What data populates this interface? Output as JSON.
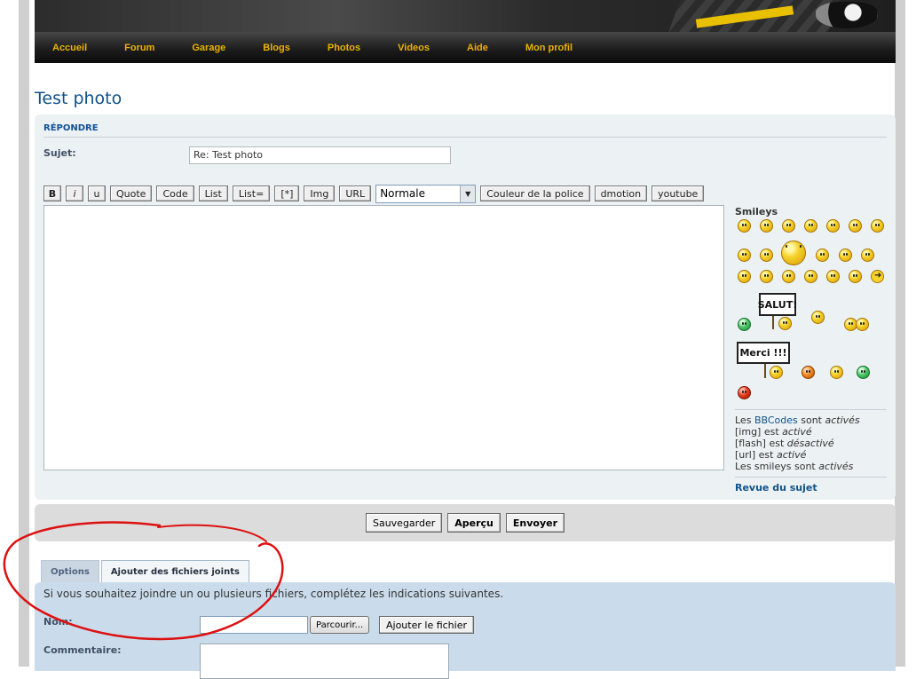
{
  "nav": {
    "items": [
      "Accueil",
      "Forum",
      "Garage",
      "Blogs",
      "Photos",
      "Videos",
      "Aide",
      "Mon profil"
    ]
  },
  "page": {
    "title": "Test photo"
  },
  "post": {
    "section_heading": "RÉPONDRE",
    "subject_label": "Sujet:",
    "subject_value": "Re: Test photo",
    "toolbar": {
      "bold": "B",
      "italic": "i",
      "underline": "u",
      "quote": "Quote",
      "code": "Code",
      "list": "List",
      "list_ordered": "List=",
      "list_item": "[*]",
      "img": "Img",
      "url": "URL",
      "font_size_selected": "Normale",
      "font_color": "Couleur de la police",
      "dmotion": "dmotion",
      "youtube": "youtube"
    }
  },
  "smileys": {
    "title": "Smileys",
    "sign_salut": "SALUT!",
    "sign_merci": "Merci !!!"
  },
  "bbinfo": {
    "line1_prefix": "Les ",
    "line1_link": "BBCodes",
    "line1_mid": " sont ",
    "line1_status": "activés",
    "line2_prefix": "[img] est ",
    "line2_status": "activé",
    "line3_prefix": "[flash] est ",
    "line3_status": "désactivé",
    "line4_prefix": "[url] est ",
    "line4_status": "activé",
    "line5_prefix": "Les smileys sont ",
    "line5_status": "activés",
    "review_link": "Revue du sujet"
  },
  "submit": {
    "save": "Sauvegarder",
    "preview": "Aperçu",
    "send": "Envoyer"
  },
  "tabs": {
    "options": "Options",
    "attachments": "Ajouter des fichiers joints"
  },
  "attach": {
    "intro": "Si vous souhaitez joindre un ou plusieurs fichiers, complétez les indications suivantes.",
    "name_label": "Nom:",
    "browse": "Parcourir...",
    "add_file": "Ajouter le fichier",
    "comment_label": "Commentaire:"
  },
  "colors": {
    "nav_text": "#e9b400",
    "title": "#105289",
    "annotation": "#dd1111"
  }
}
